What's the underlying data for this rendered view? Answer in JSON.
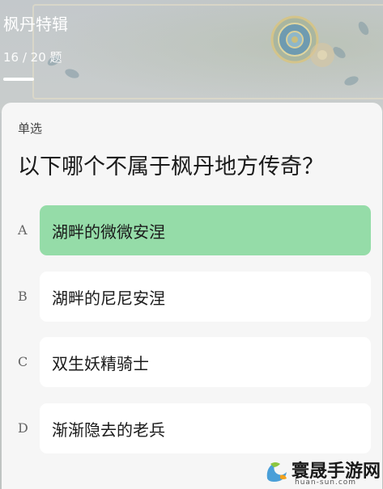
{
  "header": {
    "title": "枫丹特辑",
    "progress_text": "16 / 20 题",
    "progress": {
      "current": 16,
      "total": 20
    }
  },
  "question": {
    "type": "单选",
    "text": "以下哪个不属于枫丹地方传奇？",
    "options": [
      {
        "letter": "A",
        "text": "湖畔的微微安涅",
        "selected": true
      },
      {
        "letter": "B",
        "text": "湖畔的尼尼安涅",
        "selected": false
      },
      {
        "letter": "C",
        "text": "双生妖精骑士",
        "selected": false
      },
      {
        "letter": "D",
        "text": "渐渐隐去的老兵",
        "selected": false
      }
    ]
  },
  "watermark": {
    "name": "寰晟手游网",
    "url": "huan-sun.com"
  },
  "colors": {
    "selected": "#95dca8",
    "card": "#f6f6f6",
    "option": "#ffffff"
  }
}
